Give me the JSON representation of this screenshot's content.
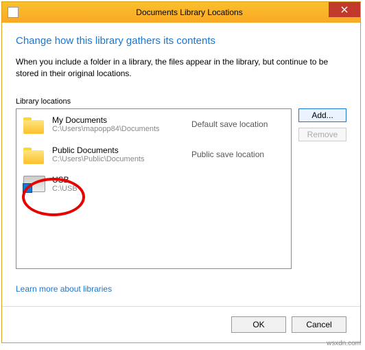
{
  "titlebar": {
    "title": "Documents Library Locations"
  },
  "heading": "Change how this library gathers its contents",
  "description": "When you include a folder in a library, the files appear in the library, but continue to be stored in their original locations.",
  "section_label": "Library locations",
  "locations": [
    {
      "title": "My Documents",
      "path": "C:\\Users\\mapopp84\\Documents",
      "status": "Default save location"
    },
    {
      "title": "Public Documents",
      "path": "C:\\Users\\Public\\Documents",
      "status": "Public save location"
    },
    {
      "title": "USB",
      "path": "C:\\USB",
      "status": ""
    }
  ],
  "buttons": {
    "add": "Add...",
    "remove": "Remove"
  },
  "learn_link": "Learn more about libraries",
  "footer": {
    "ok": "OK",
    "cancel": "Cancel"
  },
  "watermark": "wsxdn.com"
}
